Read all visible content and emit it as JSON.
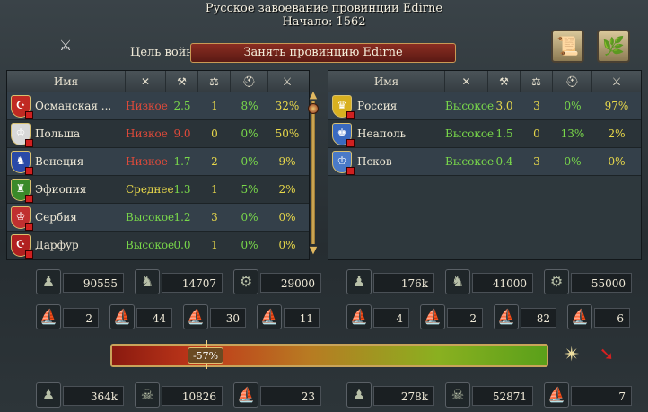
{
  "header": {
    "title": "Русское завоевание провинции Edirne",
    "start": "Начало: 1562"
  },
  "wargoal": {
    "label": "Цель войны",
    "value": "Занять провинцию Edirne"
  },
  "columns": {
    "name": "Имя"
  },
  "attackers": [
    {
      "name": "Османская ...",
      "participation": "Низкое",
      "p_color": "r",
      "war_exhaustion": "2.5",
      "we_color": "g",
      "stability": "1",
      "morale_loss": "8%",
      "manpower_loss": "32%",
      "flag_color": "#c02a22",
      "flag_symbol": "☪"
    },
    {
      "name": "Польша",
      "participation": "Низкое",
      "p_color": "r",
      "war_exhaustion": "9.0",
      "we_color": "r",
      "stability": "0",
      "morale_loss": "0%",
      "manpower_loss": "50%",
      "flag_color": "#d8d8d8",
      "flag_symbol": "♔"
    },
    {
      "name": "Венеция",
      "participation": "Низкое",
      "p_color": "r",
      "war_exhaustion": "1.7",
      "we_color": "g",
      "stability": "2",
      "morale_loss": "0%",
      "manpower_loss": "9%",
      "flag_color": "#2a4aa8",
      "flag_symbol": "♞"
    },
    {
      "name": "Эфиопия",
      "participation": "Среднее",
      "p_color": "y",
      "war_exhaustion": "1.3",
      "we_color": "g",
      "stability": "1",
      "morale_loss": "5%",
      "manpower_loss": "2%",
      "flag_color": "#3a8a2a",
      "flag_symbol": "♜"
    },
    {
      "name": "Сербия",
      "participation": "Высокое",
      "p_color": "g",
      "war_exhaustion": "1.2",
      "we_color": "g",
      "stability": "3",
      "morale_loss": "0%",
      "manpower_loss": "0%",
      "flag_color": "#c03030",
      "flag_symbol": "♔"
    },
    {
      "name": "Дарфур",
      "participation": "Высокое",
      "p_color": "g",
      "war_exhaustion": "0.0",
      "we_color": "g",
      "stability": "1",
      "morale_loss": "0%",
      "manpower_loss": "0%",
      "flag_color": "#b02020",
      "flag_symbol": "☪"
    }
  ],
  "defenders": [
    {
      "name": "Россия",
      "participation": "Высокое",
      "p_color": "g",
      "war_exhaustion": "3.0",
      "we_color": "y",
      "stability": "3",
      "morale_loss": "0%",
      "manpower_loss": "97%",
      "flag_color": "#d8b020",
      "flag_symbol": "♛"
    },
    {
      "name": "Неаполь",
      "participation": "Высокое",
      "p_color": "g",
      "war_exhaustion": "1.5",
      "we_color": "g",
      "stability": "0",
      "morale_loss": "13%",
      "manpower_loss": "2%",
      "flag_color": "#3a6ac0",
      "flag_symbol": "♚"
    },
    {
      "name": "Псков",
      "participation": "Высокое",
      "p_color": "g",
      "war_exhaustion": "0.4",
      "we_color": "g",
      "stability": "3",
      "morale_loss": "0%",
      "manpower_loss": "0%",
      "flag_color": "#4a7ac8",
      "flag_symbol": "♔"
    }
  ],
  "attacker_forces": {
    "infantry": "90555",
    "cavalry": "14707",
    "artillery": "29000",
    "heavy_ships": "2",
    "light_ships": "44",
    "galleys": "30",
    "transports": "11"
  },
  "defender_forces": {
    "infantry": "176k",
    "cavalry": "41000",
    "artillery": "55000",
    "heavy_ships": "4",
    "light_ships": "2",
    "galleys": "82",
    "transports": "6"
  },
  "warscore": {
    "label": "-57%",
    "value_percent": -57
  },
  "attacker_losses": {
    "army": "364k",
    "army_attrition": "10826",
    "navy": "23"
  },
  "defender_losses": {
    "army": "278k",
    "army_attrition": "52871",
    "navy": "7"
  },
  "colors": {
    "good": "#79d84a",
    "bad": "#e04a3a",
    "medium": "#e8d84a",
    "accent": "#c9a45a"
  }
}
